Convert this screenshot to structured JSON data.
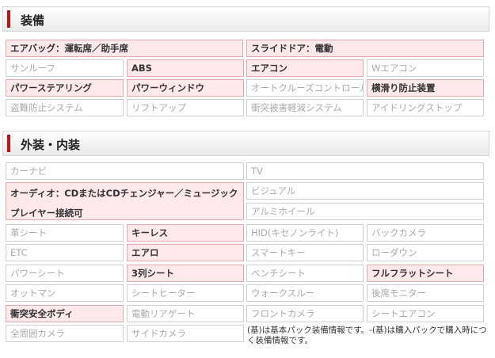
{
  "sections": {
    "equipment": {
      "title": "装備"
    },
    "exterior": {
      "title": "外装・内装"
    }
  },
  "equipment": {
    "airbag": "エアバッグ：運転席／助手席",
    "slide_door": "スライドドア：電動",
    "sunroof": "サンルーフ",
    "abs": "ABS",
    "aircon": "エアコン",
    "w_aircon": "Wエアコン",
    "power_steering": "パワーステアリング",
    "power_window": "パワーウィンドウ",
    "cruise_control": "オートクルーズコントロール",
    "anti_skid": "横滑り防止装置",
    "anti_theft": "盗難防止システム",
    "lift_up": "リフトアップ",
    "collision_mitigation": "衝突被害軽減システム",
    "idling_stop": "アイドリングストップ"
  },
  "exterior": {
    "car_navi": "カーナビ",
    "tv": "TV",
    "audio": "オーディオ：CDまたはCDチェンジャー／ミュージックプレイヤー接続可",
    "visual": "ビジュアル",
    "alloy_wheel": "アルミホイール",
    "leather_seat": "革シート",
    "keyless": "キーレス",
    "hid": "HID(キセノンライト)",
    "back_camera": "バックカメラ",
    "etc": "ETC",
    "aero": "エアロ",
    "smart_key": "スマートキー",
    "lowdown": "ローダウン",
    "power_seat": "パワーシート",
    "third_row_seat": "3列シート",
    "bench_seat": "ベンチシート",
    "full_flat_seat": "フルフラットシート",
    "ottoman": "オットマン",
    "seat_heater": "シートヒーター",
    "walk_through": "ウォークスルー",
    "rear_monitor": "後席モニター",
    "crash_safety_body": "衝突安全ボディ",
    "power_rear_gate": "電動リアゲート",
    "front_camera": "フロントカメラ",
    "seat_aircon": "シートエアコン",
    "around_view_camera": "全周囲カメラ",
    "side_camera": "サイドカメラ",
    "note": "(基)は基本パック装備情報です。-(基)は購入パックで購入時につく装備情報です。"
  },
  "colors": {
    "accent": "#c4101a",
    "active_bg": "#fde8ea",
    "active_border": "#e7a7ad",
    "inactive_text": "#aaaaaa"
  }
}
